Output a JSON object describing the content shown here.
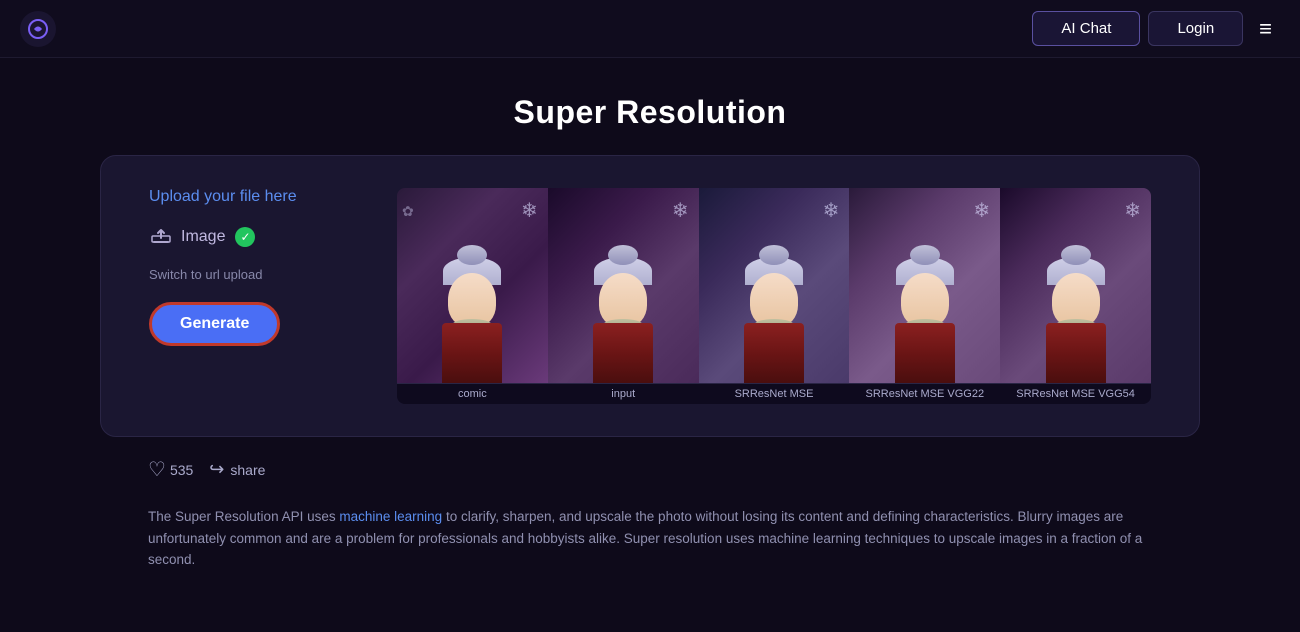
{
  "navbar": {
    "logo_alt": "App Logo",
    "ai_chat_label": "AI Chat",
    "login_label": "Login",
    "hamburger_icon": "≡"
  },
  "page": {
    "title": "Super Resolution"
  },
  "card": {
    "upload_label": "Upload your file here",
    "image_button_label": "Image",
    "check_icon": "✓",
    "switch_url_label": "Switch to url upload",
    "generate_label": "Generate"
  },
  "image_labels": {
    "comic": "comic",
    "input": "input",
    "srresnet_mse": "SRResNet MSE",
    "srresnet_vgg22": "SRResNet MSE VGG22",
    "srresnet_vgg54": "SRResNet MSE VGG54"
  },
  "actions": {
    "like_count": "535",
    "share_label": "share"
  },
  "description": {
    "text_before": "The Super Resolution API uses ",
    "ml_link_text": "machine learning",
    "text_after": " to clarify, sharpen, and upscale the photo without losing its content and defining characteristics. Blurry images are unfortunately common and are a problem for professionals and hobbyists alike. Super resolution uses machine learning techniques to upscale images in a fraction of a second."
  }
}
